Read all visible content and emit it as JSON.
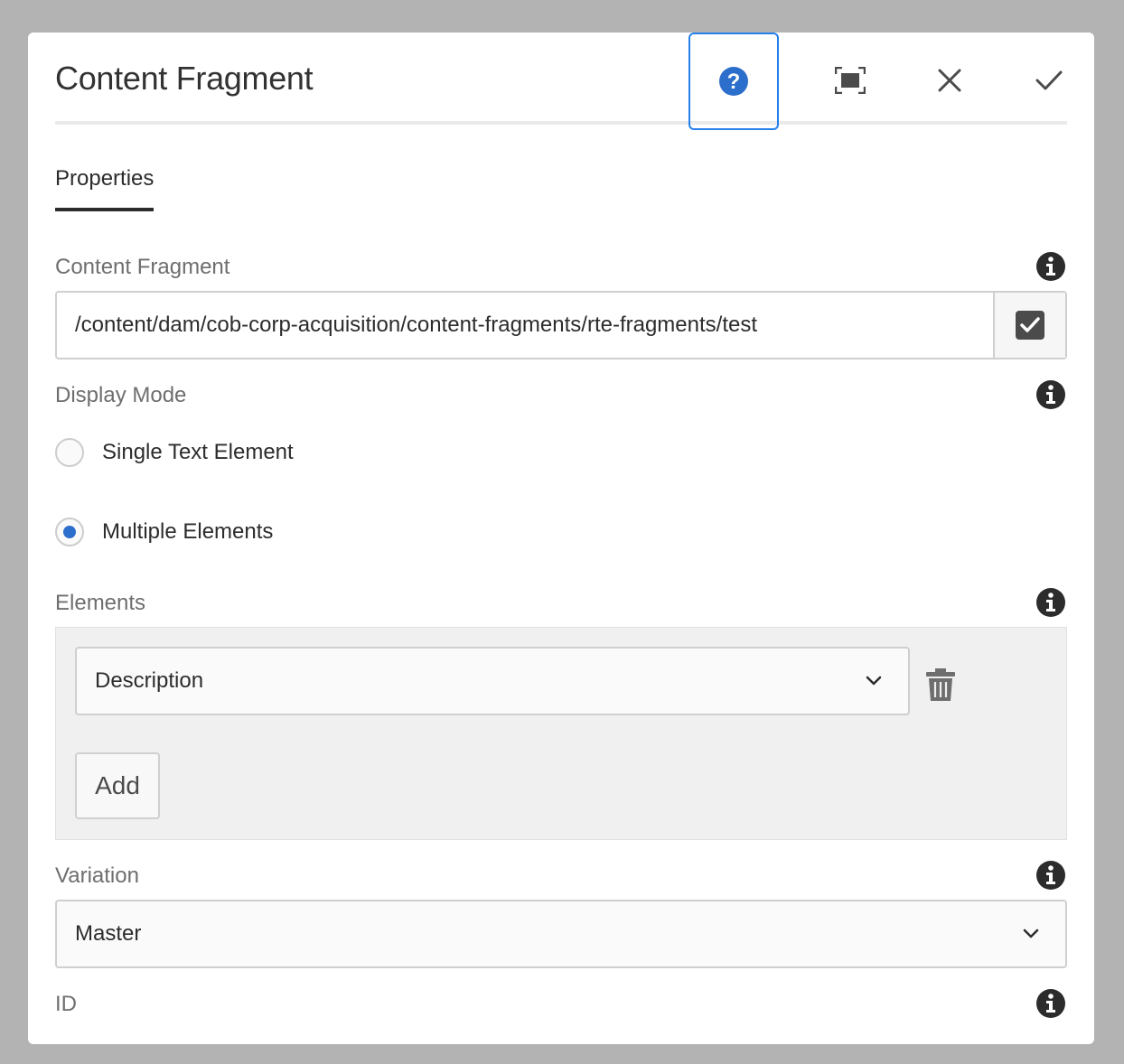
{
  "dialog": {
    "title": "Content Fragment",
    "actions": [
      "help",
      "fullscreen",
      "cancel",
      "done"
    ]
  },
  "tabs": [
    {
      "label": "Properties",
      "active": true
    }
  ],
  "fields": {
    "content_fragment": {
      "label": "Content Fragment",
      "value": "/content/dam/cob-corp-acquisition/content-fragments/rte-fragments/test"
    },
    "display_mode": {
      "label": "Display Mode",
      "options": [
        {
          "label": "Single Text Element",
          "selected": false
        },
        {
          "label": "Multiple Elements",
          "selected": true
        }
      ]
    },
    "elements": {
      "label": "Elements",
      "items": [
        "Description"
      ],
      "add_label": "Add"
    },
    "variation": {
      "label": "Variation",
      "value": "Master"
    },
    "id": {
      "label": "ID"
    }
  },
  "colors": {
    "accent": "#2680eb",
    "radio_selected": "#2c6ecb",
    "backdrop": "#b3b3b3"
  },
  "icons": {
    "help": "help-icon",
    "fullscreen": "fullscreen-icon",
    "close": "close-icon",
    "done": "checkmark-icon",
    "info": "info-icon",
    "browse": "checkbox-icon",
    "delete": "trash-icon",
    "dropdown": "chevron-down-icon"
  }
}
